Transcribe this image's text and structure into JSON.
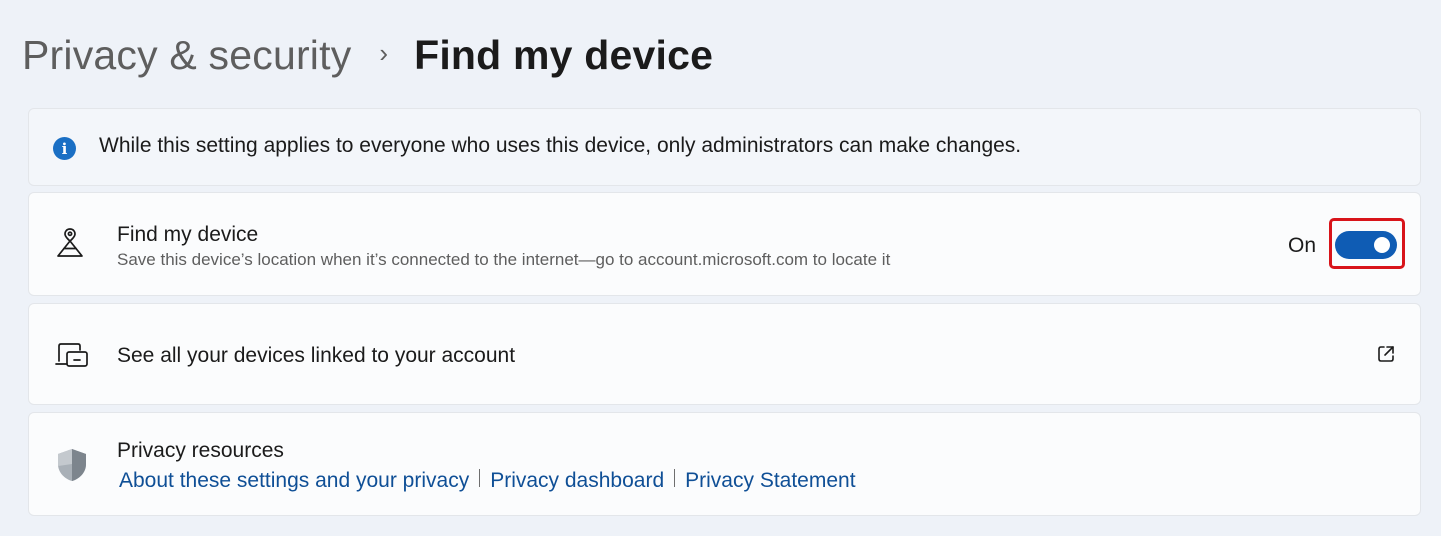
{
  "breadcrumb": {
    "parent": "Privacy & security",
    "separator": "›",
    "current": "Find my device"
  },
  "info_banner": {
    "icon": "info-icon",
    "icon_glyph": "i",
    "text": "While this setting applies to everyone who uses this device, only administrators can make changes."
  },
  "find_my_device": {
    "icon": "person-location-icon",
    "title": "Find my device",
    "description": "Save this device’s location when it’s connected to the internet—go to account.microsoft.com to locate it",
    "toggle_state_label": "On",
    "toggle_on": true,
    "accent_color": "#0f5cb4",
    "highlight_color": "#d8141a"
  },
  "linked_devices": {
    "icon": "devices-icon",
    "title": "See all your devices linked to your account",
    "action_icon": "external-link-icon"
  },
  "privacy_resources": {
    "icon": "shield-icon",
    "title": "Privacy resources",
    "links": [
      "About these settings and your privacy",
      "Privacy dashboard",
      "Privacy Statement"
    ],
    "link_color": "#0f4f96"
  }
}
